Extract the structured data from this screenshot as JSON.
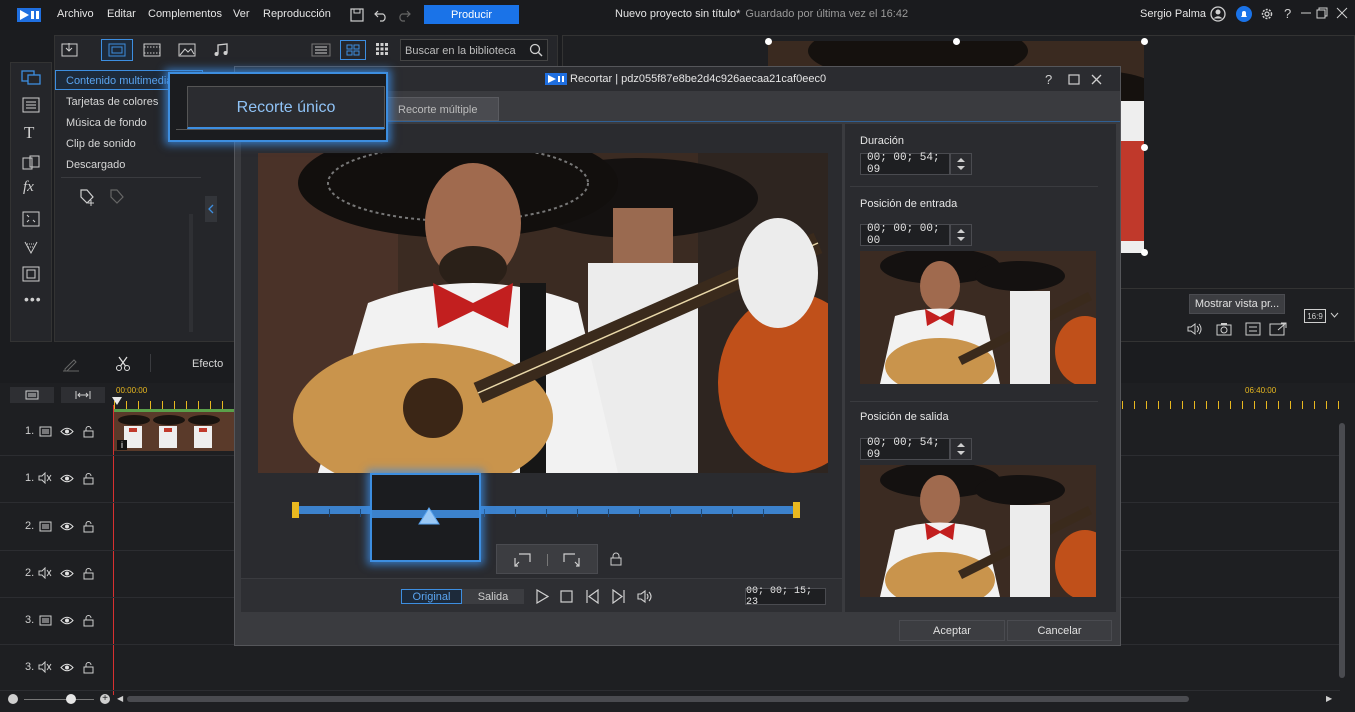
{
  "topbar": {
    "menus": [
      "Archivo",
      "Editar",
      "Complementos",
      "Ver",
      "Reproducción"
    ],
    "produce_label": "Producir",
    "project_title": "Nuevo proyecto sin título*",
    "saved_status": "Guardado por última vez el 16:42",
    "user_name": "Sergio Palma"
  },
  "library": {
    "search_placeholder": "Buscar en la biblioteca",
    "categories": [
      "Contenido multimedia",
      "Tarjetas de colores",
      "Música de fondo",
      "Clip de sonido",
      "Descargado"
    ]
  },
  "edit_toolbar": {
    "effect_label": "Efecto"
  },
  "preview_panel": {
    "mostrar_label": "Mostrar vista pr...",
    "aspect_ratio": "16:9"
  },
  "timeline": {
    "time_start": "00:00:00",
    "time_mark": "06:40:00",
    "tracks": [
      "1.",
      "1.",
      "2.",
      "2.",
      "3.",
      "3."
    ]
  },
  "trim_dialog": {
    "title": "Recortar | pdz055f87e8be2d4c926aecaa21caf0eec0",
    "tab_single": "Recorte único",
    "tab_multiple": "Recorte múltiple",
    "duration_label": "Duración",
    "duration_value": "00; 00; 54; 09",
    "in_label": "Posición de entrada",
    "in_value": "00; 00; 00; 00",
    "out_label": "Posición de salida",
    "out_value": "00; 00; 54; 09",
    "original_label": "Original",
    "salida_label": "Salida",
    "current_time": "00; 00; 15; 23",
    "accept_label": "Aceptar",
    "cancel_label": "Cancelar",
    "playhead_fraction": 0.26
  },
  "colors": {
    "accent": "#1a73e8",
    "highlight_blue": "#3d8ee0",
    "trim_bar": "#3c82cc",
    "marker_yellow": "#e8b820",
    "playhead_red": "#d83030"
  }
}
